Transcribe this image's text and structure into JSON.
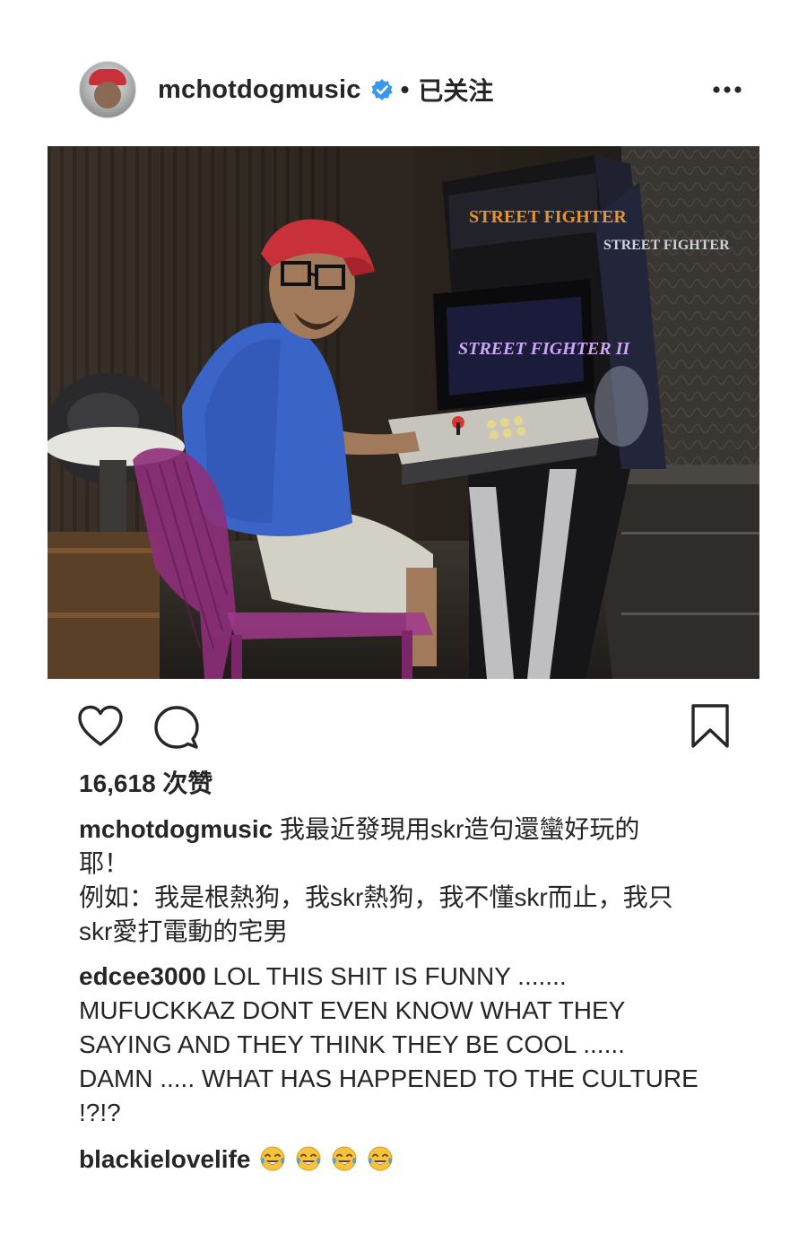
{
  "post": {
    "username": "mchotdogmusic",
    "separator": "•",
    "follow_status": "已关注",
    "likes": "16,618 次赞",
    "caption_user": "mchotdogmusic",
    "caption_text": " 我最近發現用skr造句還蠻好玩的\n耶！\n例如：我是根熱狗，我skr熱狗，我不懂skr而止，我只\nskr愛打電動的宅男"
  },
  "photo": {
    "marquee_text": "STREET FIGHTER",
    "screen_text": "STREET FIGHTER II",
    "side_text": "STREET FIGHTER"
  },
  "comments": [
    {
      "user": "edcee3000",
      "text": " LOL THIS SHIT IS FUNNY .......\nMUFUCKKAZ DONT EVEN KNOW WHAT THEY\nSAYING AND THEY THINK THEY BE COOL ......\nDAMN ..... WHAT HAS HAPPENED TO THE CULTURE\n!?!?"
    },
    {
      "user": "blackielovelife",
      "emoji_name": "tears-of-joy-emoji",
      "emoji_count": 4
    }
  ],
  "icons": {
    "verified": "verified-badge-icon",
    "more": "more-options-icon",
    "like": "heart-icon",
    "comment": "comment-bubble-icon",
    "save": "bookmark-icon"
  },
  "colors": {
    "verified_blue": "#3897f0",
    "text": "#262626",
    "cap_red": "#c8303a",
    "shirt_blue": "#3a64c8",
    "chair_purple": "#8e2f7a"
  }
}
